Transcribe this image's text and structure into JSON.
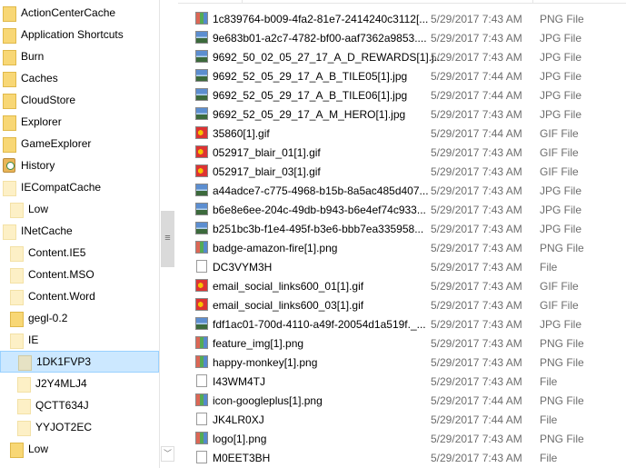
{
  "nav_tree": [
    {
      "label": "ActionCenterCache",
      "level": 0,
      "icon": "folder-icon"
    },
    {
      "label": "Application Shortcuts",
      "level": 0,
      "icon": "folder-icon"
    },
    {
      "label": "Burn",
      "level": 0,
      "icon": "folder-icon"
    },
    {
      "label": "Caches",
      "level": 0,
      "icon": "folder-icon"
    },
    {
      "label": "CloudStore",
      "level": 0,
      "icon": "folder-icon"
    },
    {
      "label": "Explorer",
      "level": 0,
      "icon": "folder-icon"
    },
    {
      "label": "GameExplorer",
      "level": 0,
      "icon": "folder-icon"
    },
    {
      "label": "History",
      "level": 0,
      "icon": "history-icon"
    },
    {
      "label": "IECompatCache",
      "level": 0,
      "icon": "folder-hidden-icon"
    },
    {
      "label": "Low",
      "level": 1,
      "icon": "folder-hidden-icon"
    },
    {
      "label": "INetCache",
      "level": 0,
      "icon": "folder-hidden-icon"
    },
    {
      "label": "Content.IE5",
      "level": 1,
      "icon": "folder-hidden-icon"
    },
    {
      "label": "Content.MSO",
      "level": 1,
      "icon": "folder-hidden-icon"
    },
    {
      "label": "Content.Word",
      "level": 1,
      "icon": "folder-hidden-icon"
    },
    {
      "label": "gegl-0.2",
      "level": 1,
      "icon": "folder-icon"
    },
    {
      "label": "IE",
      "level": 1,
      "icon": "folder-hidden-icon"
    },
    {
      "label": "1DK1FVP3",
      "level": 2,
      "icon": "folder-hidden-icon",
      "selected": true
    },
    {
      "label": "J2Y4MLJ4",
      "level": 2,
      "icon": "folder-hidden-icon"
    },
    {
      "label": "QCTT634J",
      "level": 2,
      "icon": "folder-hidden-icon"
    },
    {
      "label": "YYJOT2EC",
      "level": 2,
      "icon": "folder-hidden-icon"
    },
    {
      "label": "Low",
      "level": 1,
      "icon": "folder-icon"
    }
  ],
  "files": [
    {
      "name": "1c839764-b009-4fa2-81e7-2414240c3112[...",
      "date": "5/29/2017 7:43 AM",
      "type": "PNG File",
      "icon": "png"
    },
    {
      "name": "9e683b01-a2c7-4782-bf00-aaf7362a9853....",
      "date": "5/29/2017 7:43 AM",
      "type": "JPG File",
      "icon": "jpg"
    },
    {
      "name": "9692_50_02_05_27_17_A_D_REWARDS[1].j...",
      "date": "5/29/2017 7:43 AM",
      "type": "JPG File",
      "icon": "jpg"
    },
    {
      "name": "9692_52_05_29_17_A_B_TILE05[1].jpg",
      "date": "5/29/2017 7:44 AM",
      "type": "JPG File",
      "icon": "jpg"
    },
    {
      "name": "9692_52_05_29_17_A_B_TILE06[1].jpg",
      "date": "5/29/2017 7:44 AM",
      "type": "JPG File",
      "icon": "jpg"
    },
    {
      "name": "9692_52_05_29_17_A_M_HERO[1].jpg",
      "date": "5/29/2017 7:43 AM",
      "type": "JPG File",
      "icon": "jpg"
    },
    {
      "name": "35860[1].gif",
      "date": "5/29/2017 7:44 AM",
      "type": "GIF File",
      "icon": "gif"
    },
    {
      "name": "052917_blair_01[1].gif",
      "date": "5/29/2017 7:43 AM",
      "type": "GIF File",
      "icon": "gif"
    },
    {
      "name": "052917_blair_03[1].gif",
      "date": "5/29/2017 7:43 AM",
      "type": "GIF File",
      "icon": "gif"
    },
    {
      "name": "a44adce7-c775-4968-b15b-8a5ac485d407...",
      "date": "5/29/2017 7:43 AM",
      "type": "JPG File",
      "icon": "jpg"
    },
    {
      "name": "b6e8e6ee-204c-49db-b943-b6e4ef74c933...",
      "date": "5/29/2017 7:43 AM",
      "type": "JPG File",
      "icon": "jpg"
    },
    {
      "name": "b251bc3b-f1e4-495f-b3e6-bbb7ea335958...",
      "date": "5/29/2017 7:43 AM",
      "type": "JPG File",
      "icon": "jpg"
    },
    {
      "name": "badge-amazon-fire[1].png",
      "date": "5/29/2017 7:43 AM",
      "type": "PNG File",
      "icon": "png"
    },
    {
      "name": "DC3VYM3H",
      "date": "5/29/2017 7:43 AM",
      "type": "File",
      "icon": "blank"
    },
    {
      "name": "email_social_links600_01[1].gif",
      "date": "5/29/2017 7:43 AM",
      "type": "GIF File",
      "icon": "gif"
    },
    {
      "name": "email_social_links600_03[1].gif",
      "date": "5/29/2017 7:43 AM",
      "type": "GIF File",
      "icon": "gif"
    },
    {
      "name": "fdf1ac01-700d-4110-a49f-20054d1a519f._...",
      "date": "5/29/2017 7:43 AM",
      "type": "JPG File",
      "icon": "jpg"
    },
    {
      "name": "feature_img[1].png",
      "date": "5/29/2017 7:43 AM",
      "type": "PNG File",
      "icon": "png"
    },
    {
      "name": "happy-monkey[1].png",
      "date": "5/29/2017 7:43 AM",
      "type": "PNG File",
      "icon": "png"
    },
    {
      "name": "I43WM4TJ",
      "date": "5/29/2017 7:43 AM",
      "type": "File",
      "icon": "blank"
    },
    {
      "name": "icon-googleplus[1].png",
      "date": "5/29/2017 7:44 AM",
      "type": "PNG File",
      "icon": "png"
    },
    {
      "name": "JK4LR0XJ",
      "date": "5/29/2017 7:44 AM",
      "type": "File",
      "icon": "blank"
    },
    {
      "name": "logo[1].png",
      "date": "5/29/2017 7:43 AM",
      "type": "PNG File",
      "icon": "png"
    },
    {
      "name": "M0EET3BH",
      "date": "5/29/2017 7:43 AM",
      "type": "File",
      "icon": "blank"
    }
  ],
  "colors": {
    "selection_bg": "#cce8ff",
    "selection_border": "#99d1ff",
    "secondary_text": "#6d6d6d"
  }
}
